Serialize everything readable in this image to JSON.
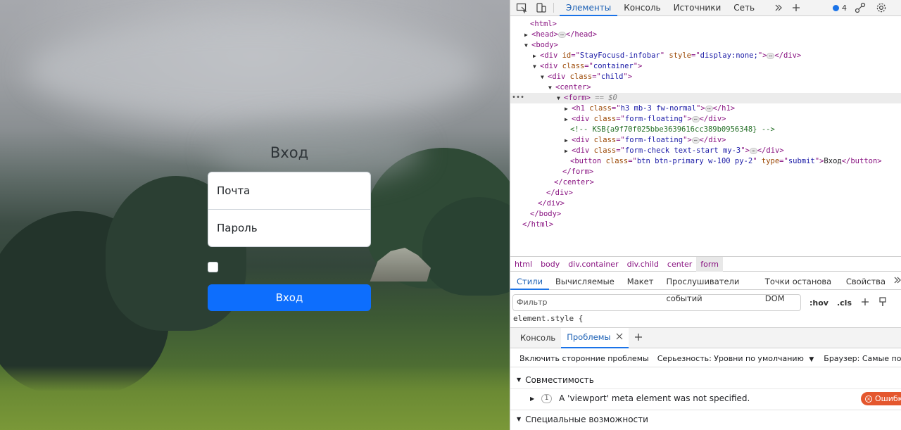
{
  "page": {
    "form_title": "Вход",
    "email_placeholder": "Почта",
    "password_placeholder": "Пароль",
    "submit_label": "Вход"
  },
  "devtools": {
    "panel_tabs": [
      "Элементы",
      "Консоль",
      "Источники",
      "Сеть"
    ],
    "issues_count": "4",
    "dom_lines": [
      {
        "parts": [
          [
            "tg",
            "<html>"
          ]
        ]
      },
      {
        "parts": [
          [
            "tg",
            "<head>"
          ],
          [
            "ell",
            "⋯"
          ],
          [
            "tg",
            "</head>"
          ]
        ]
      },
      {
        "parts": [
          [
            "tg",
            "<body>"
          ]
        ]
      },
      {
        "parts": [
          [
            "tg",
            "<div "
          ],
          [
            "an",
            "id"
          ],
          [
            "tg",
            "=\""
          ],
          [
            "av",
            "StayFocusd-infobar"
          ],
          [
            "tg",
            "\" "
          ],
          [
            "an",
            "style"
          ],
          [
            "tg",
            "=\""
          ],
          [
            "av",
            "display:none;"
          ],
          [
            "tg",
            "\">"
          ],
          [
            "ell",
            "⋯"
          ],
          [
            "tg",
            "</div>"
          ]
        ]
      },
      {
        "parts": [
          [
            "tg",
            "<div "
          ],
          [
            "an",
            "class"
          ],
          [
            "tg",
            "=\""
          ],
          [
            "av",
            "container"
          ],
          [
            "tg",
            "\">"
          ]
        ]
      },
      {
        "parts": [
          [
            "tg",
            "<div "
          ],
          [
            "an",
            "class"
          ],
          [
            "tg",
            "=\""
          ],
          [
            "av",
            "child"
          ],
          [
            "tg",
            "\">"
          ]
        ]
      },
      {
        "parts": [
          [
            "tg",
            "<center>"
          ]
        ]
      },
      {
        "parts": [
          [
            "tg",
            "<form>"
          ],
          [
            "eq",
            " == $0"
          ]
        ]
      },
      {
        "parts": [
          [
            "tg",
            "<h1 "
          ],
          [
            "an",
            "class"
          ],
          [
            "tg",
            "=\""
          ],
          [
            "av",
            "h3 mb-3 fw-normal"
          ],
          [
            "tg",
            "\">"
          ],
          [
            "ell",
            "⋯"
          ],
          [
            "tg",
            "</h1>"
          ]
        ]
      },
      {
        "parts": [
          [
            "tg",
            "<div "
          ],
          [
            "an",
            "class"
          ],
          [
            "tg",
            "=\""
          ],
          [
            "av",
            "form-floating"
          ],
          [
            "tg",
            "\">"
          ],
          [
            "ell",
            "⋯"
          ],
          [
            "tg",
            "</div>"
          ]
        ]
      },
      {
        "parts": [
          [
            "cm",
            "<!-- KSB{a9f70f025bbe3639616cc389b0956348} -->"
          ]
        ]
      },
      {
        "parts": [
          [
            "tg",
            "<div "
          ],
          [
            "an",
            "class"
          ],
          [
            "tg",
            "=\""
          ],
          [
            "av",
            "form-floating"
          ],
          [
            "tg",
            "\">"
          ],
          [
            "ell",
            "⋯"
          ],
          [
            "tg",
            "</div>"
          ]
        ]
      },
      {
        "parts": [
          [
            "tg",
            "<div "
          ],
          [
            "an",
            "class"
          ],
          [
            "tg",
            "=\""
          ],
          [
            "av",
            "form-check text-start my-3"
          ],
          [
            "tg",
            "\">"
          ],
          [
            "ell",
            "⋯"
          ],
          [
            "tg",
            "</div>"
          ]
        ]
      },
      {
        "parts": [
          [
            "tg",
            "<button "
          ],
          [
            "an",
            "class"
          ],
          [
            "tg",
            "=\""
          ],
          [
            "av",
            "btn btn-primary w-100 py-2"
          ],
          [
            "tg",
            "\" "
          ],
          [
            "an",
            "type"
          ],
          [
            "tg",
            "=\""
          ],
          [
            "av",
            "submit"
          ],
          [
            "tg",
            "\">"
          ],
          [
            "tx",
            "Вход"
          ],
          [
            "tg",
            "</button>"
          ]
        ]
      },
      {
        "parts": [
          [
            "tg",
            "</form>"
          ]
        ]
      },
      {
        "parts": [
          [
            "tg",
            "</center>"
          ]
        ]
      },
      {
        "parts": [
          [
            "tg",
            "</div>"
          ]
        ]
      },
      {
        "parts": [
          [
            "tg",
            "</div>"
          ]
        ]
      },
      {
        "parts": [
          [
            "tg",
            "</body>"
          ]
        ]
      },
      {
        "parts": [
          [
            "tg",
            "</html>"
          ]
        ]
      }
    ],
    "breadcrumbs": [
      "html",
      "body",
      "div.container",
      "div.child",
      "center",
      "form"
    ],
    "styles_tabs": [
      "Стили",
      "Вычисляемые",
      "Макет",
      "Прослушиватели событий",
      "Точки останова DOM",
      "Свойства"
    ],
    "filter_placeholder": "Фильтр",
    "hov_label": ":hov",
    "cls_label": ".cls",
    "element_style": "element.style {",
    "drawer_tabs": [
      "Консоль",
      "Проблемы"
    ],
    "third_party_label": "Включить сторонние проблемы",
    "severity_label": "Серьезность: Уровни по умолчанию",
    "browser_label": "Браузер: Самые популярные",
    "compat_label": "Совместимость",
    "issue_count": "1",
    "issue_text": "A 'viewport' meta element was not specified.",
    "error_label": "Ошибк",
    "a11y_label": "Специальные возможности"
  }
}
